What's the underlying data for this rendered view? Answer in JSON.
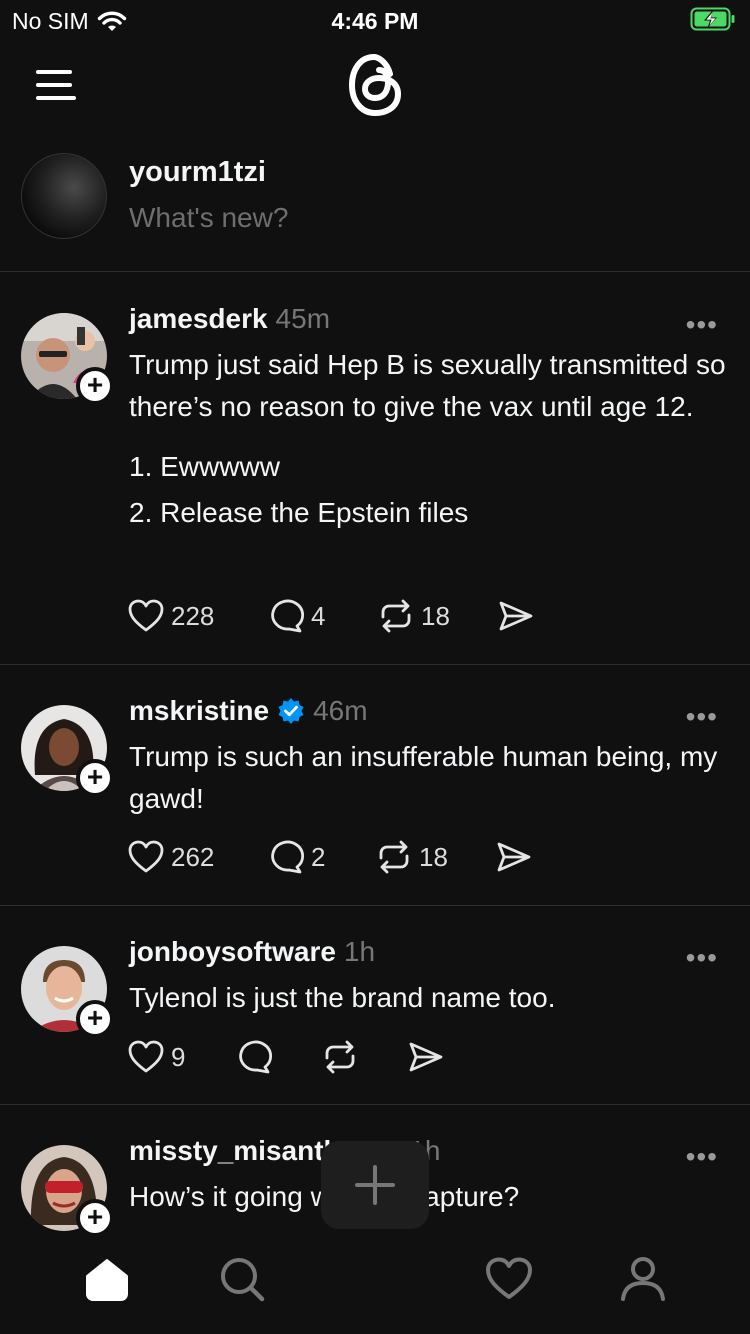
{
  "status": {
    "carrier": "No SIM",
    "time": "4:46 PM"
  },
  "composer": {
    "username": "yourm1tzi",
    "placeholder": "What's new?"
  },
  "posts": [
    {
      "username": "jamesderk",
      "time": "45m",
      "verified": false,
      "paragraphs": [
        "Trump just said Hep B is sexually transmitted so there’s no reason to give the vax until age 12.",
        "1. Ewwwww",
        "2. Release the Epstein files"
      ],
      "likes": "228",
      "replies": "4",
      "reposts": "18"
    },
    {
      "username": "mskristine",
      "time": "46m",
      "verified": true,
      "paragraphs": [
        "Trump is such an insufferable human being, my gawd!"
      ],
      "likes": "262",
      "replies": "2",
      "reposts": "18"
    },
    {
      "username": "jonboysoftware",
      "time": "1h",
      "verified": false,
      "paragraphs": [
        "Tylenol is just the brand name too."
      ],
      "likes": "9",
      "replies": "",
      "reposts": ""
    },
    {
      "username": "missty_misanthrope",
      "time": "1h",
      "verified": false,
      "paragraphs": [
        "How’s it going with the rapture?"
      ],
      "likes": "",
      "replies": "",
      "reposts": ""
    }
  ],
  "more_label": "•••",
  "colors": {
    "background": "#101010",
    "text": "#f3f5f7",
    "muted": "#777777",
    "verified": "#0095f6",
    "battery": "#4cd964"
  },
  "icons": {
    "status": [
      "wifi-icon",
      "battery-charging-icon"
    ],
    "header": [
      "menu-icon",
      "threads-logo-icon"
    ],
    "actions": [
      "heart-icon",
      "comment-icon",
      "repost-icon",
      "share-icon"
    ],
    "tabbar": [
      "home-icon",
      "search-icon",
      "plus-icon",
      "heart-icon",
      "profile-icon"
    ]
  }
}
